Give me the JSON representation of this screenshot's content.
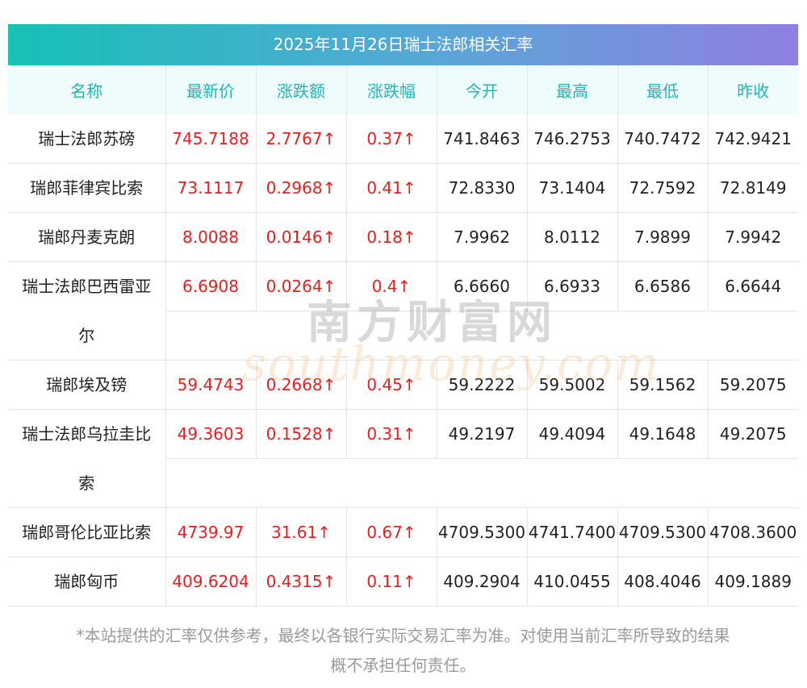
{
  "title": "2025年11月26日瑞士法郎相关汇率",
  "headers": [
    "名称",
    "最新价",
    "涨跌额",
    "涨跌幅",
    "今开",
    "最高",
    "最低",
    "昨收"
  ],
  "rows": [
    {
      "name": "瑞士法郎苏磅",
      "latest": "745.7188",
      "change": "2.7767↑",
      "pct": "0.37↑",
      "open": "741.8463",
      "high": "746.2753",
      "low": "740.7472",
      "prev": "742.9421"
    },
    {
      "name": "瑞郎菲律宾比索",
      "latest": "73.1117",
      "change": "0.2968↑",
      "pct": "0.41↑",
      "open": "72.8330",
      "high": "73.1404",
      "low": "72.7592",
      "prev": "72.8149"
    },
    {
      "name": "瑞郎丹麦克朗",
      "latest": "8.0088",
      "change": "0.0146↑",
      "pct": "0.18↑",
      "open": "7.9962",
      "high": "8.0112",
      "low": "7.9899",
      "prev": "7.9942"
    },
    {
      "name": "瑞士法郎巴西雷亚",
      "name_cont": "尔",
      "latest": "6.6908",
      "change": "0.0264↑",
      "pct": "0.4↑",
      "open": "6.6660",
      "high": "6.6933",
      "low": "6.6586",
      "prev": "6.6644"
    },
    {
      "name": "瑞郎埃及镑",
      "latest": "59.4743",
      "change": "0.2668↑",
      "pct": "0.45↑",
      "open": "59.2222",
      "high": "59.5002",
      "low": "59.1562",
      "prev": "59.2075"
    },
    {
      "name": "瑞士法郎乌拉圭比",
      "name_cont": "索",
      "latest": "49.3603",
      "change": "0.1528↑",
      "pct": "0.31↑",
      "open": "49.2197",
      "high": "49.4094",
      "low": "49.1648",
      "prev": "49.2075"
    },
    {
      "name": "瑞郎哥伦比亚比索",
      "latest": "4739.97",
      "change": "31.61↑",
      "pct": "0.67↑",
      "open": "4709.5300",
      "high": "4741.7400",
      "low": "4709.5300",
      "prev": "4708.3600"
    },
    {
      "name": "瑞郎匈币",
      "latest": "409.6204",
      "change": "0.4315↑",
      "pct": "0.11↑",
      "open": "409.2904",
      "high": "410.0455",
      "low": "408.4046",
      "prev": "409.1889"
    }
  ],
  "watermark": {
    "cn": "南方财富网",
    "en": "southmoney.com"
  },
  "footnote": {
    "line1": "*本站提供的汇率仅供参考，最终以各银行实际交易汇率为准。对使用当前汇率所导致的结果",
    "line2": "概不承担任何责任。"
  },
  "colors": {
    "header_text": "#23b4b4",
    "up": "#ee1c1c",
    "gradient_start": "#16c1b6",
    "gradient_end": "#8f7fe0"
  }
}
